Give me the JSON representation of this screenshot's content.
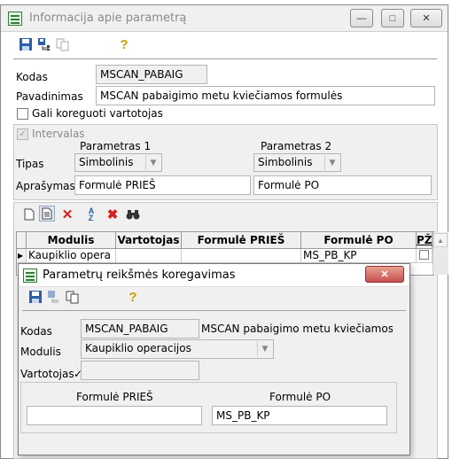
{
  "main_window": {
    "title": "Informacija apie parametrą",
    "controls": {
      "minimize": "—",
      "maximize": "□",
      "close": "✕"
    },
    "toolbar": {
      "help": "?"
    },
    "kodas_label": "Kodas",
    "kodas_value": "MSCAN_PABAIG",
    "pavadinimas_label": "Pavadinimas",
    "pavadinimas_value": "MSCAN pabaigimo metu kviečiamos formulės",
    "gali_label": "Gali koreguoti vartotojas",
    "intervalas_label": "Intervalas",
    "param1_header": "Parametras 1",
    "param2_header": "Parametras 2",
    "tipas_label": "Tipas",
    "tipas1": "Simbolinis",
    "tipas2": "Simbolinis",
    "aprasymas_label": "Aprašymas",
    "aprasymas1": "Formulė PRIEŠ",
    "aprasymas2": "Formulė PO",
    "grid": {
      "columns": [
        "Modulis",
        "Vartotojas",
        "Formulė PRIEŠ",
        "Formulė PO",
        "PŽ"
      ],
      "rows": [
        {
          "marker": "▶",
          "modulis": "Kaupiklio opera",
          "vartotojas": "",
          "pries": "",
          "po": "MS_PB_KP"
        }
      ]
    }
  },
  "dialog": {
    "title": "Parametrų reikšmės koregavimas",
    "controls": {
      "close": "✕"
    },
    "toolbar": {
      "help": "?"
    },
    "kodas_label": "Kodas",
    "kodas_value": "MSCAN_PABAIG",
    "kodas_desc": "MSCAN pabaigimo metu kviečiamos fo",
    "modulis_label": "Modulis",
    "modulis_value": "Kaupiklio operacijos",
    "vartotojas_label": "Vartotojas",
    "vartotojas_mark": "✓",
    "pries_label": "Formulė PRIEŠ",
    "pries_value": "",
    "po_label": "Formulė PO",
    "po_value": "MS_PB_KP"
  }
}
